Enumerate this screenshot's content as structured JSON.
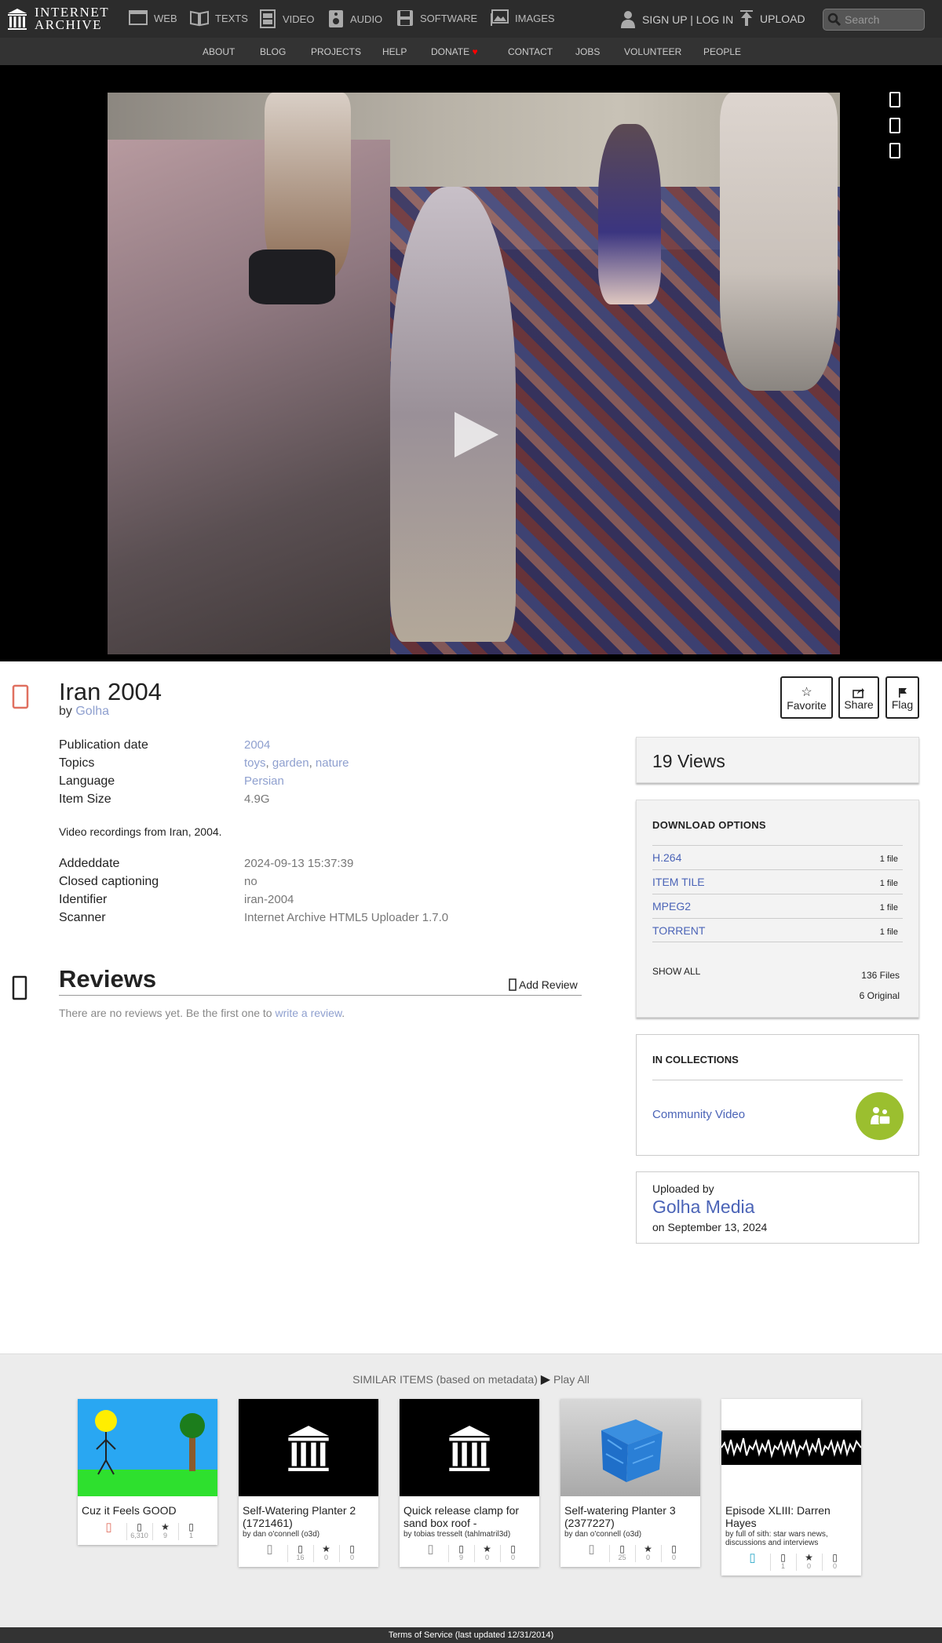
{
  "nav": {
    "logo_line1": "INTERNET",
    "logo_line2": "ARCHIVE",
    "media": [
      "WEB",
      "TEXTS",
      "VIDEO",
      "AUDIO",
      "SOFTWARE",
      "IMAGES"
    ],
    "signup": "SIGN UP | LOG IN",
    "upload": "UPLOAD",
    "search_placeholder": "Search"
  },
  "subnav": [
    "ABOUT",
    "BLOG",
    "PROJECTS",
    "HELP",
    "DONATE",
    "CONTACT",
    "JOBS",
    "VOLUNTEER",
    "PEOPLE"
  ],
  "item": {
    "title": "Iran 2004",
    "by_label": "by",
    "author": "Golha",
    "actions": [
      "Favorite",
      "Share",
      "Flag"
    ],
    "metadata1": [
      {
        "label": "Publication date",
        "value": "2004"
      },
      {
        "label": "Topics",
        "links": [
          "toys",
          "garden",
          "nature"
        ]
      },
      {
        "label": "Language",
        "value": "Persian"
      },
      {
        "label": "Item Size",
        "value": "4.9G"
      }
    ],
    "description": "Video recordings from Iran, 2004.",
    "metadata2": [
      {
        "label": "Addeddate",
        "value": "2024-09-13 15:37:39"
      },
      {
        "label": "Closed captioning",
        "value": "no"
      },
      {
        "label": "Identifier",
        "value": "iran-2004"
      },
      {
        "label": "Scanner",
        "value": "Internet Archive HTML5 Uploader 1.7.0"
      }
    ]
  },
  "reviews": {
    "title": "Reviews",
    "add": "Add Review",
    "empty_text": "There are no reviews yet. Be the first one to",
    "empty_link": "write a review",
    "empty_end": "."
  },
  "stats": {
    "views": "19 Views"
  },
  "downloads": {
    "title": "DOWNLOAD OPTIONS",
    "options": [
      {
        "name": "H.264",
        "count": "1 file"
      },
      {
        "name": "ITEM TILE",
        "count": "1 file"
      },
      {
        "name": "MPEG2",
        "count": "1 file"
      },
      {
        "name": "TORRENT",
        "count": "1 file"
      }
    ],
    "show_all": "SHOW ALL",
    "total_files": "136 Files",
    "original": "6 Original"
  },
  "collections": {
    "title": "IN COLLECTIONS",
    "items": [
      "Community Video"
    ]
  },
  "uploader": {
    "label": "Uploaded by",
    "name": "Golha Media",
    "date": "on September 13, 2024"
  },
  "similar": {
    "heading": "SIMILAR ITEMS (based on metadata)",
    "play_all": "Play All",
    "items": [
      {
        "title": "Cuz it Feels GOOD",
        "by": "",
        "views": "6,310",
        "favs": "9",
        "reviews": "1"
      },
      {
        "title": "Self-Watering Planter 2 (1721461)",
        "by": "by dan o'connell (o3d)",
        "views": "16",
        "favs": "0",
        "reviews": "0"
      },
      {
        "title": "Quick release clamp for sand box roof -",
        "by": "by tobias tresselt (tahlmatril3d)",
        "views": "9",
        "favs": "0",
        "reviews": "0"
      },
      {
        "title": "Self-watering Planter 3 (2377227)",
        "by": "by dan o'connell (o3d)",
        "views": "25",
        "favs": "0",
        "reviews": "0"
      },
      {
        "title": "Episode XLIII: Darren Hayes",
        "by": "by full of sith: star wars news, discussions and interviews",
        "views": "1",
        "favs": "0",
        "reviews": "0"
      }
    ]
  },
  "footer": "Terms of Service (last updated 12/31/2014)",
  "colors": {
    "brand": "#2c2c2c",
    "link": "#4b64b7",
    "collection_icon": "#9bbf2f",
    "donate_heart": "#ff0000"
  }
}
